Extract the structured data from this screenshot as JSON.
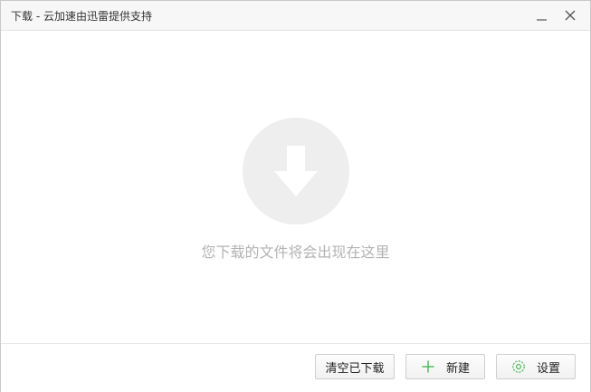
{
  "window": {
    "title": "下载 - 云加速由迅雷提供支持"
  },
  "main": {
    "empty_message": "您下载的文件将会出现在这里"
  },
  "footer": {
    "clear_label": "清空已下载",
    "new_label": "新建",
    "settings_label": "设置"
  },
  "icons": {
    "minimize": "minimize-icon",
    "close": "close-icon",
    "download": "download-arrow-icon",
    "plus": "plus-icon",
    "gear": "gear-icon"
  },
  "colors": {
    "accent_green": "#3bb34a",
    "empty_circle": "#eeeeee",
    "empty_text": "#b3b3b3"
  }
}
